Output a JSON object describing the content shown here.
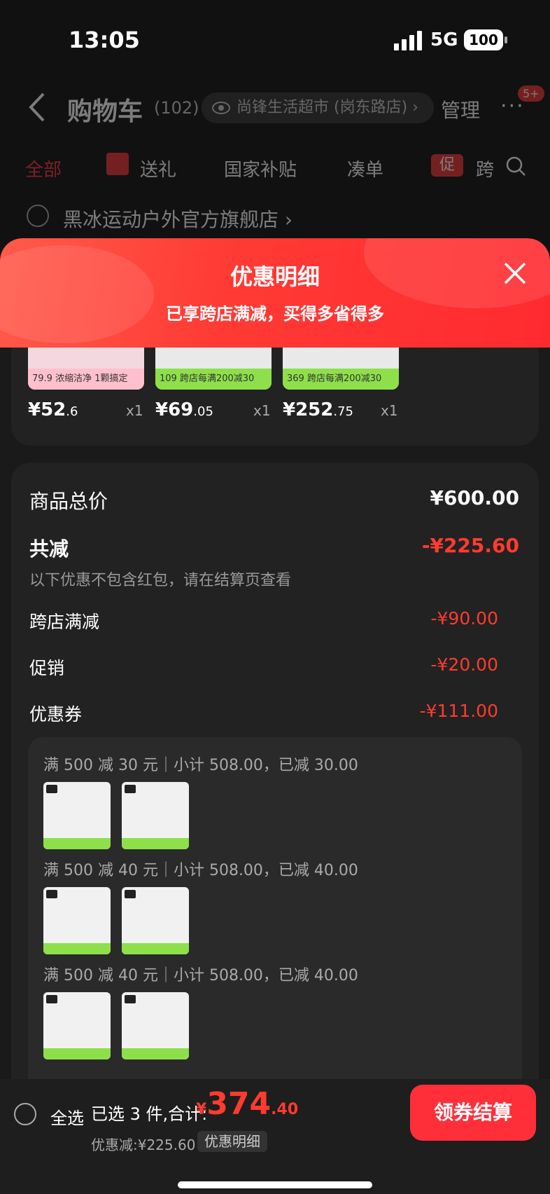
{
  "status": {
    "time": "13:05",
    "network": "5G",
    "battery": "100"
  },
  "nav": {
    "title": "购物车",
    "count": "(102)",
    "store": "尚锋生活超市 (岗东路店)",
    "store_chevron": "›",
    "manage": "管理",
    "more": "···",
    "badge": "5+"
  },
  "tabs": {
    "all": "全部",
    "gift": "送礼",
    "subsidy": "国家补贴",
    "order": "凑单",
    "promo_icon": "促",
    "cross": "跨"
  },
  "store_row": {
    "name": "黑冰运动户外官方旗舰店 ›"
  },
  "sheet": {
    "title": "优惠明细",
    "subtitle": "已享跨店满减，买得多省得多"
  },
  "products": [
    {
      "tag": "79.9 浓缩洁净 1颗搞定",
      "price_int": "¥52",
      "price_dec": ".6",
      "qty": "x1",
      "color": "#f3d8df",
      "tag_color": "#ffc0cb"
    },
    {
      "tag": "109 跨店每满200减30",
      "price_int": "¥69",
      "price_dec": ".05",
      "qty": "x1",
      "color": "#e9e9ea",
      "tag_color": "#8ee04b"
    },
    {
      "tag": "369 跨店每满200减30",
      "price_int": "¥252",
      "price_dec": ".75",
      "qty": "x1",
      "color": "#e9e9ea",
      "tag_color": "#8ee04b"
    }
  ],
  "summary": {
    "total_label": "商品总价",
    "total_value": "¥600.00",
    "reduce_label": "共减",
    "reduce_value": "-¥225.60",
    "note": "以下优惠不包含红包，请在结算页查看",
    "cross_label": "跨店满减",
    "cross_value": "-¥90.00",
    "promo_label": "促销",
    "promo_value": "-¥20.00",
    "coupon_label": "优惠券",
    "coupon_value": "-¥111.00"
  },
  "groups": [
    {
      "text": "满 500 减 30 元｜小计 508.00，已减 30.00"
    },
    {
      "text": "满 500 减 40 元｜小计 508.00，已减 40.00"
    },
    {
      "text": "满 500 减 40 元｜小计 508.00，已减 40.00"
    }
  ],
  "bottom": {
    "select_all": "全选",
    "selected": "已选 3 件,合计:",
    "currency": "¥",
    "total_int": "374",
    "total_dec": ".40",
    "discount": "优惠减:¥225.60",
    "detail_btn": "优惠明细",
    "checkout": "领券结算"
  }
}
